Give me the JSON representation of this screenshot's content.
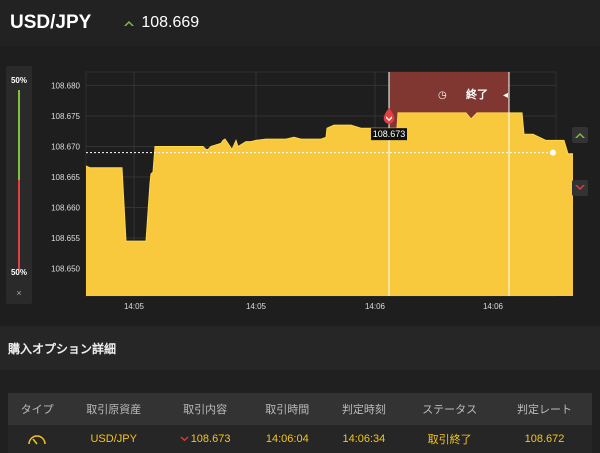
{
  "header": {
    "pair": "USD/JPY",
    "price": "108.669"
  },
  "side_panel": {
    "top_pct": "50%",
    "bottom_pct": "50%",
    "close": "×"
  },
  "chart": {
    "end_label": "終了",
    "current_marker": "108.673",
    "colors": {
      "fill": "#f8c93d",
      "line": "#ffd84a",
      "end_zone": "#8c3a33",
      "up": "#7fc241",
      "down": "#e04040"
    }
  },
  "chart_data": {
    "type": "area",
    "y_ticks": [
      "108.680",
      "108.675",
      "108.670",
      "108.665",
      "108.660",
      "108.655",
      "108.650"
    ],
    "x_ticks": [
      "14:05",
      "14:05",
      "14:06",
      "14:06"
    ],
    "ylim": [
      108.6455,
      108.6822
    ],
    "x": [
      0,
      4,
      12,
      36,
      40,
      60,
      64,
      65,
      67,
      69,
      71,
      75,
      85,
      97,
      102,
      117,
      120,
      122,
      125,
      135,
      137,
      139,
      142,
      146,
      150,
      152,
      157,
      160,
      165,
      170,
      180,
      200,
      208,
      215,
      220,
      235,
      240,
      241,
      248,
      255,
      265,
      275,
      285,
      295,
      305,
      311,
      312,
      380,
      385,
      391,
      395,
      431,
      436,
      438,
      447,
      460,
      467,
      478,
      482,
      487
    ],
    "y": [
      108.6668,
      108.6665,
      108.6665,
      108.6665,
      108.6545,
      108.6545,
      108.664,
      108.6655,
      108.6658,
      108.67,
      108.67,
      108.67,
      108.67,
      108.67,
      108.67,
      108.67,
      108.6695,
      108.6695,
      108.67,
      108.6705,
      108.671,
      108.6712,
      108.6705,
      108.6695,
      108.671,
      108.67,
      108.6705,
      108.6708,
      108.6708,
      108.671,
      108.6712,
      108.6712,
      108.6715,
      108.6712,
      108.6712,
      108.6712,
      108.6715,
      108.673,
      108.6735,
      108.6735,
      108.6735,
      108.673,
      108.673,
      108.673,
      108.673,
      108.673,
      108.6755,
      108.6755,
      108.6745,
      108.6755,
      108.6755,
      108.6755,
      108.6755,
      108.672,
      108.672,
      108.671,
      108.671,
      108.671,
      108.6688,
      108.6688
    ],
    "x_tick_positions": [
      48,
      170,
      289,
      407
    ],
    "current_price": 108.669,
    "entry_price": 108.673
  },
  "section": {
    "title": "購入オプション詳細"
  },
  "table": {
    "headers": [
      "タイプ",
      "取引原資産",
      "取引内容",
      "取引時間",
      "判定時刻",
      "ステータス",
      "判定レート"
    ],
    "row": [
      "",
      "USD/JPY",
      "108.673",
      "14:06:04",
      "14:06:34",
      "取引終了",
      "108.672"
    ]
  }
}
